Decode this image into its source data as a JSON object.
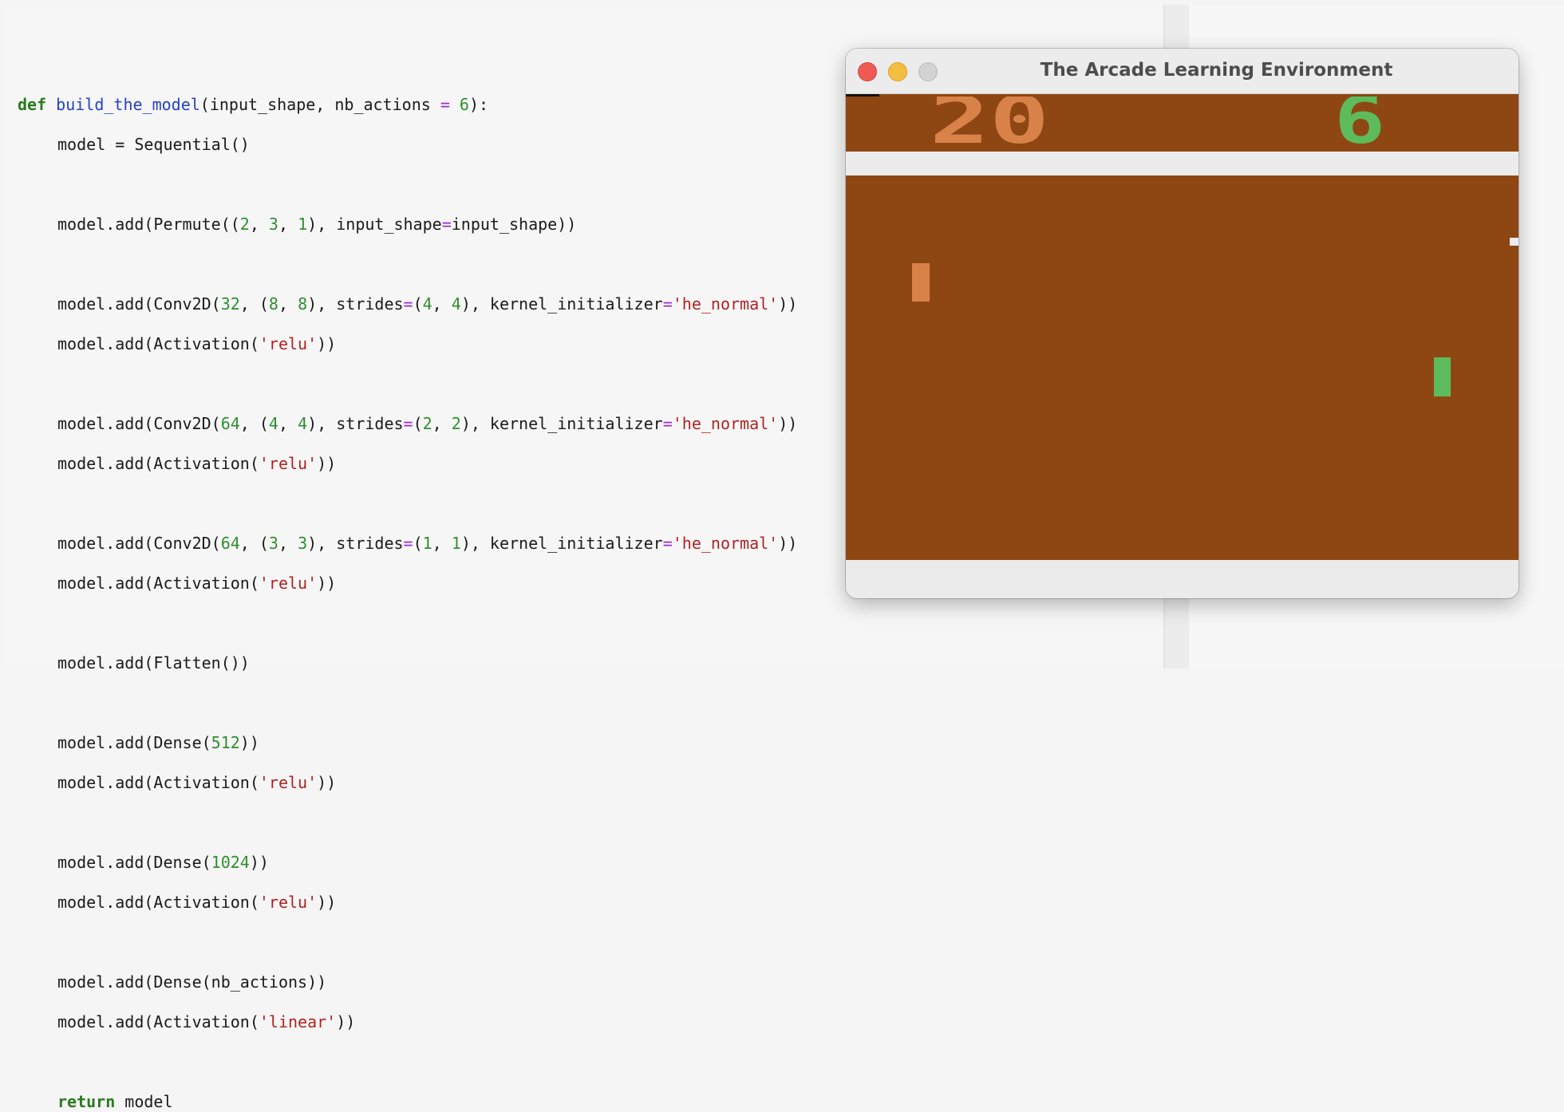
{
  "editor": {
    "code": {
      "line1": {
        "kw": "def",
        "fn": "build_the_model",
        "a": "(input_shape, nb_actions ",
        "eq": "=",
        "sp": " ",
        "n6": "6",
        "end": "):"
      },
      "line2": {
        "text": "model = Sequential()"
      },
      "line3": {
        "a": "model.add(Permute((",
        "n1": "2",
        "c1": ", ",
        "n2": "3",
        "c2": ", ",
        "n3": "1",
        "b": "), input_shape",
        "eq": "=",
        "c": "input_shape))"
      },
      "line4": {
        "a": "model.add(Conv2D(",
        "n1": "32",
        "b": ", (",
        "n2": "8",
        "c1": ", ",
        "n3": "8",
        "c": "), strides",
        "eq": "=",
        "d": "(",
        "n4": "4",
        "c2": ", ",
        "n5": "4",
        "e": "), kernel_initializer",
        "eq2": "=",
        "s": "'he_normal'",
        "f": "))"
      },
      "line5": {
        "a": "model.add(Activation(",
        "s": "'relu'",
        "b": "))"
      },
      "line6": {
        "a": "model.add(Conv2D(",
        "n1": "64",
        "b": ", (",
        "n2": "4",
        "c1": ", ",
        "n3": "4",
        "c": "), strides",
        "eq": "=",
        "d": "(",
        "n4": "2",
        "c2": ", ",
        "n5": "2",
        "e": "), kernel_initializer",
        "eq2": "=",
        "s": "'he_normal'",
        "f": "))"
      },
      "line7": {
        "a": "model.add(Activation(",
        "s": "'relu'",
        "b": "))"
      },
      "line8": {
        "a": "model.add(Conv2D(",
        "n1": "64",
        "b": ", (",
        "n2": "3",
        "c1": ", ",
        "n3": "3",
        "c": "), strides",
        "eq": "=",
        "d": "(",
        "n4": "1",
        "c2": ", ",
        "n5": "1",
        "e": "), kernel_initializer",
        "eq2": "=",
        "s": "'he_normal'",
        "f": "))"
      },
      "line9": {
        "a": "model.add(Activation(",
        "s": "'relu'",
        "b": "))"
      },
      "line10": {
        "text": "model.add(Flatten())"
      },
      "line11": {
        "a": "model.add(Dense(",
        "n": "512",
        "b": "))"
      },
      "line12": {
        "a": "model.add(Activation(",
        "s": "'relu'",
        "b": "))"
      },
      "line13": {
        "a": "model.add(Dense(",
        "n": "1024",
        "b": "))"
      },
      "line14": {
        "a": "model.add(Activation(",
        "s": "'relu'",
        "b": "))"
      },
      "line15": {
        "text": "model.add(Dense(nb_actions))"
      },
      "line16": {
        "a": "model.add(Activation(",
        "s": "'linear'",
        "b": "))"
      },
      "line17": {
        "kw": "return",
        "b": " model"
      }
    }
  },
  "window": {
    "title": "The Arcade Learning Environment",
    "game": {
      "score_left": "20",
      "score_right": "6",
      "colors": {
        "background": "#8e4713",
        "left_player": "#d88249",
        "right_player": "#5dbb5b",
        "wall": "#ececec"
      }
    }
  }
}
